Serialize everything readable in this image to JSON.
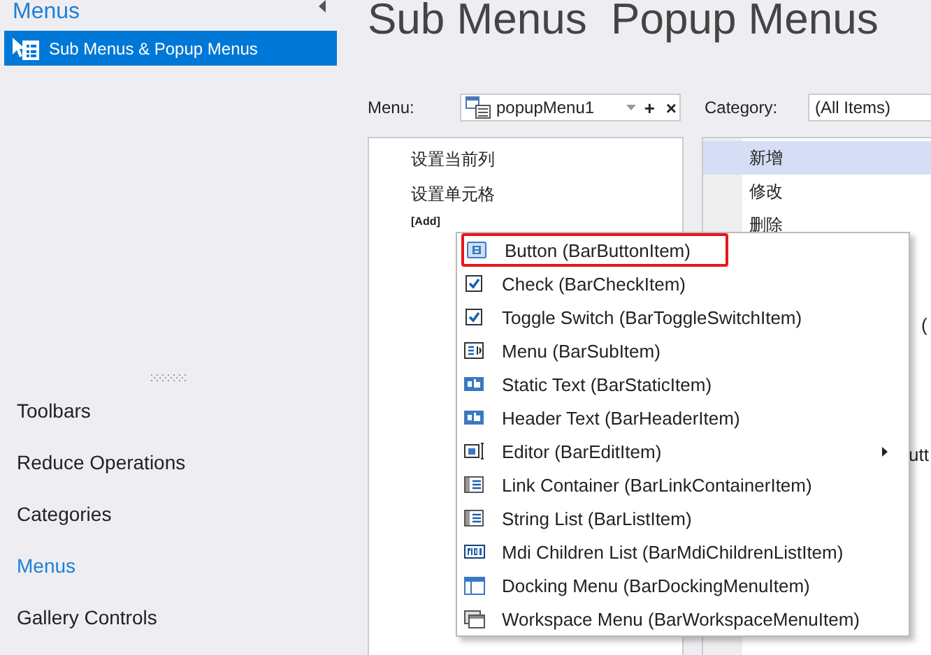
{
  "sidebar": {
    "group_title": "Menus",
    "sub_items": [
      {
        "label": "Sub Menus & Popup Menus",
        "selected": true
      }
    ],
    "items": [
      {
        "label": "Toolbars",
        "selected": false
      },
      {
        "label": "Reduce Operations",
        "selected": false
      },
      {
        "label": "Categories",
        "selected": false
      },
      {
        "label": "Menus",
        "selected": true
      },
      {
        "label": "Gallery Controls",
        "selected": false
      }
    ]
  },
  "title": "Sub Menus  Popup Menus",
  "menu_field": {
    "label": "Menu:",
    "value": "popupMenu1",
    "add": "+",
    "remove": "×"
  },
  "category_field": {
    "label": "Category:",
    "value": "(All Items)"
  },
  "menu_items": [
    "设置当前列",
    "设置单元格"
  ],
  "add_label": "[Add]",
  "category_items": [
    {
      "label": "新增",
      "selected": true
    },
    {
      "label": "修改",
      "selected": false
    },
    {
      "label": "删除",
      "selected": false
    }
  ],
  "fragments": [
    "(",
    "utt"
  ],
  "popup": [
    {
      "kind": "button",
      "label": "Button (BarButtonItem)",
      "highlighted": true,
      "submenu": false
    },
    {
      "kind": "check",
      "label": "Check (BarCheckItem)",
      "highlighted": false,
      "submenu": false
    },
    {
      "kind": "check",
      "label": "Toggle Switch (BarToggleSwitchItem)",
      "highlighted": false,
      "submenu": false
    },
    {
      "kind": "menu",
      "label": "Menu (BarSubItem)",
      "highlighted": false,
      "submenu": false
    },
    {
      "kind": "text",
      "label": "Static Text (BarStaticItem)",
      "highlighted": false,
      "submenu": false
    },
    {
      "kind": "text",
      "label": "Header Text (BarHeaderItem)",
      "highlighted": false,
      "submenu": false
    },
    {
      "kind": "editor",
      "label": "Editor (BarEditItem)",
      "highlighted": false,
      "submenu": true
    },
    {
      "kind": "list",
      "label": "Link Container (BarLinkContainerItem)",
      "highlighted": false,
      "submenu": false
    },
    {
      "kind": "list",
      "label": "String List (BarListItem)",
      "highlighted": false,
      "submenu": false
    },
    {
      "kind": "mdi",
      "label": "Mdi Children List (BarMdiChildrenListItem)",
      "highlighted": false,
      "submenu": false
    },
    {
      "kind": "docking",
      "label": "Docking Menu (BarDockingMenuItem)",
      "highlighted": false,
      "submenu": false
    },
    {
      "kind": "workspace",
      "label": "Workspace Menu (BarWorkspaceMenuItem)",
      "highlighted": false,
      "submenu": false
    }
  ]
}
